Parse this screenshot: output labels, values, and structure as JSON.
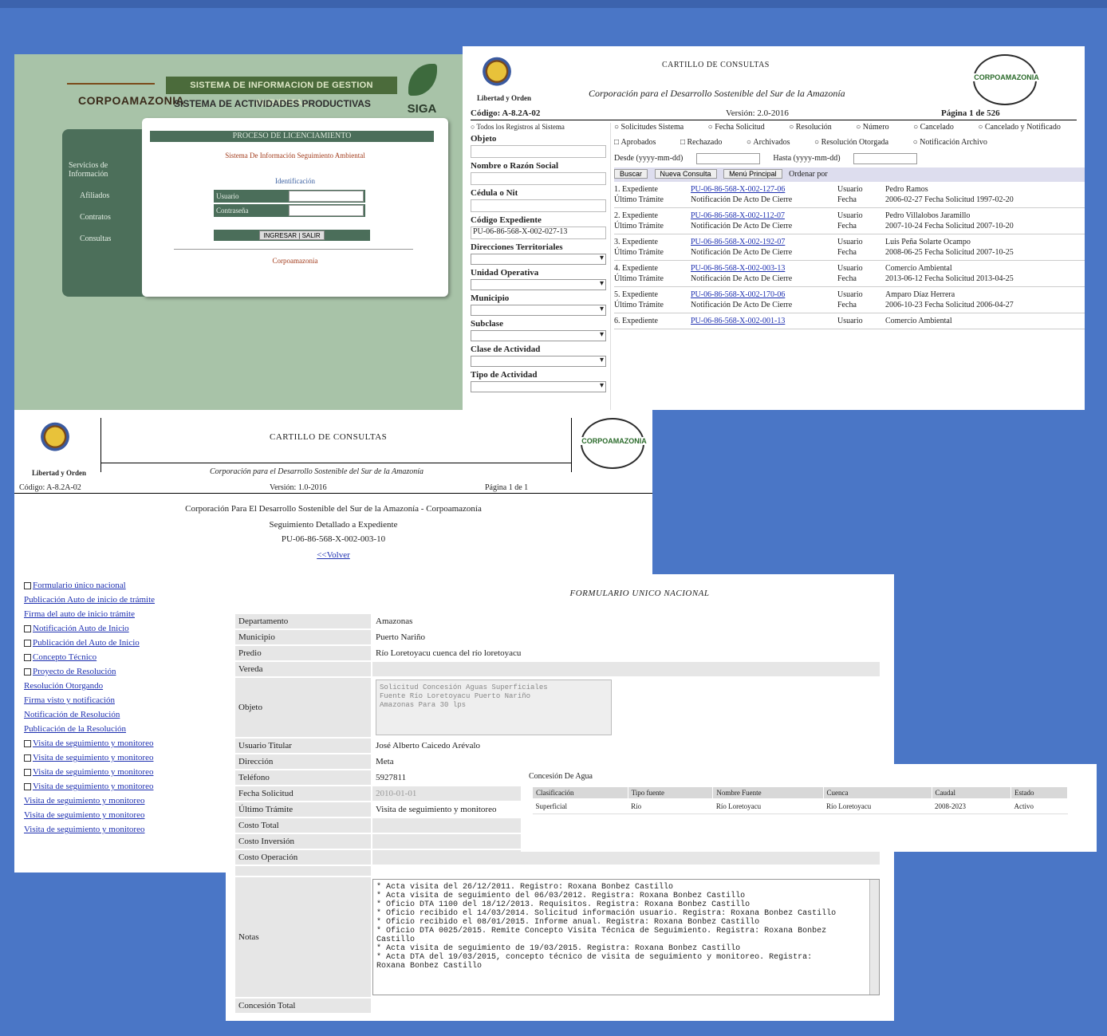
{
  "login": {
    "brand": "CORPOAMAZONIA",
    "system_banner": "SISTEMA DE INFORMACION DE GESTION AMBIENTAL",
    "system_subtitle": "SISTEMA DE ACTIVIDADES PRODUCTIVAS",
    "siga": "SIGA",
    "nav_title": "Servicios de Información",
    "nav_items": [
      "Afiliados",
      "Contratos",
      "Consultas"
    ],
    "card_title": "PROCESO DE LICENCIAMIENTO",
    "card_subtitle": "Sistema De Información Seguimiento Ambiental",
    "form_title": "Identificación",
    "user_label": "Usuario",
    "pass_label": "Contraseña",
    "login_button": "INGRESAR | SALIR",
    "footer": "Corpoamazonia"
  },
  "query": {
    "header_title": "CARTILLO DE CONSULTAS",
    "header_subtitle": "Corporación para el Desarrollo Sostenible del Sur de la Amazonía",
    "motto": "Libertad y Orden",
    "code": "Código: A-8.2A-02",
    "version": "Versión: 2.0-2016",
    "page": "Página 1 de 526",
    "left_fields": {
      "todos": "Todos los Registros al Sistema",
      "objeto_label": "Objeto",
      "nombre_label": "Nombre o Razón Social",
      "cedula_label": "Cédula o Nit",
      "codigo_label": "Código Expediente",
      "codigo_value": "PU-06-86-568-X-002-027-13",
      "direcciones_label": "Direcciones Territoriales",
      "unidad_label": "Unidad Operativa",
      "municipio_label": "Municipio",
      "subclase_label": "Subclase",
      "clase_label": "Clase de Actividad",
      "tipo_label": "Tipo de Actividad"
    },
    "radios_row1": [
      "Solicitudes Sistema",
      "Fecha Solicitud",
      "Resolución",
      "Número",
      "Cancelado",
      "Cancelado y Notificado"
    ],
    "radios_row2": [
      "Aprobados",
      "Rechazado",
      "Archivados",
      "Resolución Otorgada",
      "Notificación Archivo"
    ],
    "search_from": "Desde (yyyy-mm-dd)",
    "search_to": "Hasta (yyyy-mm-dd)",
    "buttons": [
      "Buscar",
      "Nueva Consulta",
      "Menú Principal"
    ],
    "order_label": "Ordenar por",
    "results": [
      {
        "n": "1. Expediente",
        "code": "PU-06-86-568-X-002-127-06",
        "ul": "Usuario",
        "user": "Pedro Ramos",
        "tl": "Último Trámite",
        "tram": "Notificación De Acto De Cierre",
        "fl": "Fecha",
        "fecha": "2006-02-27  Fecha Solicitud  1997-02-20"
      },
      {
        "n": "2. Expediente",
        "code": "PU-06-86-568-X-002-112-07",
        "ul": "Usuario",
        "user": "Pedro Villalobos Jaramillo",
        "tl": "Último Trámite",
        "tram": "Notificación De Acto De Cierre",
        "fl": "Fecha",
        "fecha": "2007-10-24  Fecha Solicitud  2007-10-20"
      },
      {
        "n": "3. Expediente",
        "code": "PU-06-86-568-X-002-192-07",
        "ul": "Usuario",
        "user": "Luis Peña Solarte Ocampo",
        "tl": "Último Trámite",
        "tram": "Notificación De Acto De Cierre",
        "fl": "Fecha",
        "fecha": "2008-06-25  Fecha Solicitud  2007-10-25"
      },
      {
        "n": "4. Expediente",
        "code": "PU-06-86-568-X-002-003-13",
        "ul": "Usuario",
        "user": "Comercio Ambiental",
        "tl": "Último Trámite",
        "tram": "Notificación De Acto De Cierre",
        "fl": "Fecha",
        "fecha": "2013-06-12  Fecha Solicitud  2013-04-25"
      },
      {
        "n": "5. Expediente",
        "code": "PU-06-86-568-X-002-170-06",
        "ul": "Usuario",
        "user": "Amparo Díaz Herrera",
        "tl": "Último Trámite",
        "tram": "Notificación De Acto De Cierre",
        "fl": "Fecha",
        "fecha": "2006-10-23  Fecha Solicitud  2006-04-27"
      },
      {
        "n": "6. Expediente",
        "code": "PU-06-86-568-X-002-001-13",
        "ul": "Usuario",
        "user": "Comercio Ambiental",
        "tl": "",
        "tram": "",
        "fl": "",
        "fecha": ""
      }
    ]
  },
  "detail": {
    "header_title": "CARTILLO DE CONSULTAS",
    "header_subtitle": "Corporación para el Desarrollo Sostenible del Sur de la Amazonía",
    "motto": "Libertad y Orden",
    "code": "Código: A-8.2A-02",
    "version": "Versión: 1.0-2016",
    "page": "Página 1 de 1",
    "line1": "Corporación Para El Desarrollo Sostenible del Sur de la Amazonía - Corpoamazonía",
    "line2": "Seguimiento Detallado a Expediente",
    "line3": "PU-06-86-568-X-002-003-10",
    "back": "<<Volver",
    "links": [
      "Formulario único nacional",
      "Publicación Auto de inicio de trámite",
      "Firma del auto de inicio trámite",
      "Notificación Auto de Inicio",
      "Publicación del Auto de Inicio",
      "Concepto Técnico",
      "Proyecto de Resolución",
      "Resolución Otorgando",
      "Firma visto y notificación",
      "Notificación de Resolución",
      "Publicación de la Resolución",
      "Visita de seguimiento y monitoreo",
      "Visita de seguimiento y monitoreo",
      "Visita de seguimiento y monitoreo",
      "Visita de seguimiento y monitoreo",
      "Visita de seguimiento y monitoreo",
      "Visita de seguimiento y monitoreo",
      "Visita de seguimiento y monitoreo"
    ]
  },
  "form": {
    "title": "FORMULARIO UNICO NACIONAL",
    "subtitle": "",
    "rows": [
      {
        "k": "Departamento",
        "v": "Amazonas"
      },
      {
        "k": "Municipio",
        "v": "Puerto Nariño"
      },
      {
        "k": "Predio",
        "v": "Río Loretoyacu cuenca del río loretoyacu"
      },
      {
        "k": "Vereda",
        "v": ""
      }
    ],
    "objeto_label": "Objeto",
    "objeto_text": "Solicitud Concesión Aguas Superficiales\nFuente Río Loretoyacu Puerto Nariño\nAmazonas Para 30 lps",
    "rows2": [
      {
        "k": "Usuario Titular",
        "v": "José Alberto Caicedo Arévalo"
      },
      {
        "k": "Dirección",
        "v": "Meta"
      },
      {
        "k": "Teléfono",
        "v": "5927811"
      },
      {
        "k": "Fecha Solicitud",
        "v": "2010-01-01"
      },
      {
        "k": "Último Trámite",
        "v": "Visita de seguimiento y monitoreo"
      },
      {
        "k": "Costo Total",
        "v": ""
      },
      {
        "k": "Costo Inversión",
        "v": ""
      },
      {
        "k": "Costo Operación",
        "v": ""
      }
    ],
    "notes_label": "Notas",
    "notes": "* Acta visita del 26/12/2011. Registro: Roxana Bonbez Castillo\n* Acta visita de seguimiento del 06/03/2012. Registra: Roxana Bonbez Castillo\n* Oficio DTA 1100 del 18/12/2013. Requisitos. Registra: Roxana Bonbez Castillo\n* Oficio recibido el 14/03/2014. Solicitud información usuario. Registra: Roxana Bonbez Castillo\n* Oficio recibido el 08/01/2015. Informe anual. Registra: Roxana Bonbez Castillo\n* Oficio DTA 0025/2015. Remite Concepto Visita Técnica de Seguimiento. Registra: Roxana Bonbez Castillo\n* Acta visita de seguimiento de 19/03/2015. Registra: Roxana Bonbez Castillo\n* Acta DTA del 19/03/2015, concepto técnico de visita de seguimiento y monitoreo. Registra:\nRoxana Bonbez Castillo",
    "last_row_label": "Concesión Total"
  },
  "water": {
    "title": "Concesión De Agua",
    "columns": [
      "Clasificación",
      "Tipo fuente",
      "Nombre Fuente",
      "Cuenca",
      "Caudal",
      "Estado"
    ],
    "rows": [
      [
        "Superficial",
        "Río",
        "Río Loretoyacu",
        "Río Loretoyacu",
        "2008-2023",
        "Activo"
      ]
    ]
  }
}
